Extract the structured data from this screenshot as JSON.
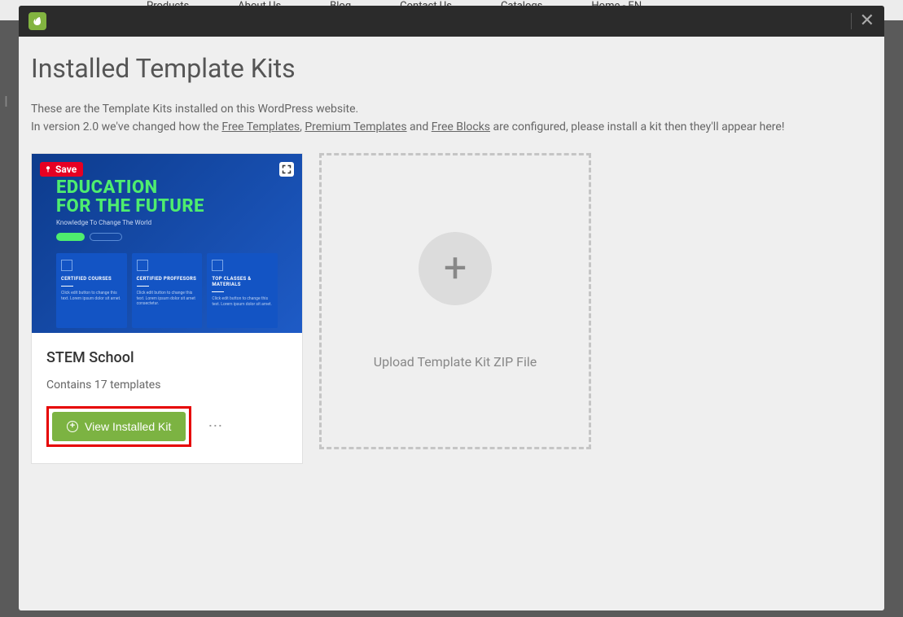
{
  "nav": {
    "items": [
      "Products",
      "About Us",
      "Blog",
      "Contact Us",
      "Catalogs",
      "Home - EN"
    ]
  },
  "modal": {
    "title": "Installed Template Kits",
    "description_line1": "These are the Template Kits installed on this WordPress website.",
    "description_prefix": "In version 2.0 we've changed how the ",
    "link_free_templates": "Free Templates",
    "sep1": ", ",
    "link_premium_templates": "Premium Templates",
    "sep2": " and ",
    "link_free_blocks": "Free Blocks",
    "description_suffix": " are configured, please install a kit then they'll appear here!"
  },
  "kit": {
    "save_label": "Save",
    "thumb_heading_line1": "EDUCATION",
    "thumb_heading_line2": "FOR THE FUTURE",
    "thumb_sub": "Knowledge To Change The World",
    "box1_title": "CERTIFIED COURSES",
    "box1_desc": "Click edit button to change this text. Lorem ipsum dolor sit amet.",
    "box2_title": "CERTIFIED PROFFESORS",
    "box2_desc": "Click edit button to change this text. Lorem ipsum dolor sit amet consectetur.",
    "box3_title": "TOP CLASSES & MATERIALS",
    "box3_desc": "Click edit button to change this text. Lorem ipsum dolor sit amet.",
    "name": "STEM School",
    "count_text": "Contains 17 templates",
    "view_button": "View Installed Kit",
    "dots": "⋯"
  },
  "upload": {
    "text": "Upload Template Kit ZIP File"
  }
}
